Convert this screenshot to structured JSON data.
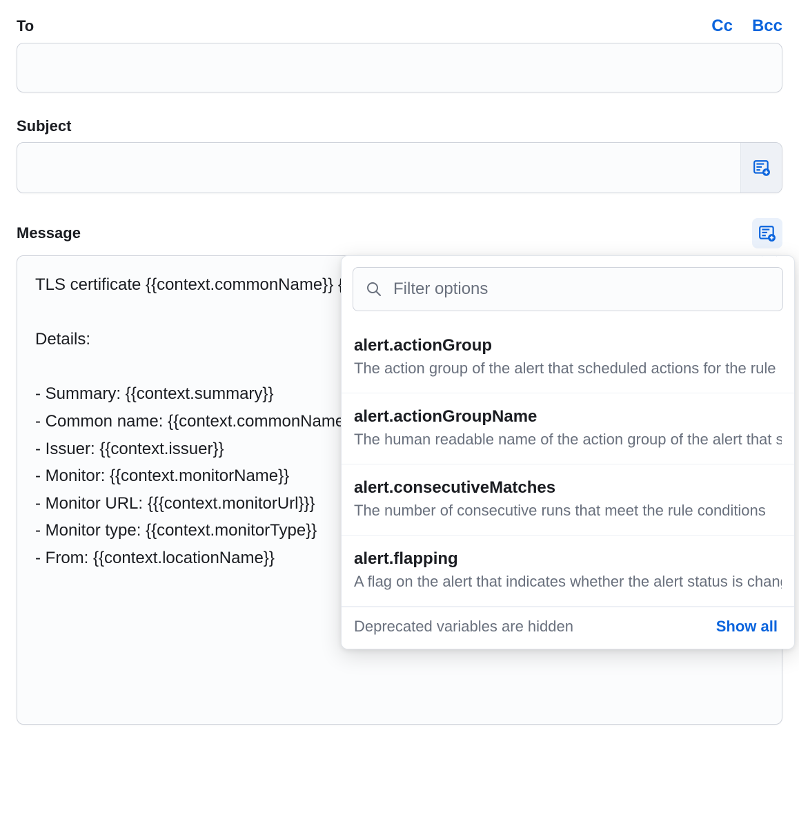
{
  "to": {
    "label": "To",
    "value": "",
    "cc_label": "Cc",
    "bcc_label": "Bcc"
  },
  "subject": {
    "label": "Subject",
    "value": ""
  },
  "message": {
    "label": "Message",
    "value": "TLS certificate {{context.commonName}} {{context.status}} - Elastic Synthetics\n\nDetails:\n\n- Summary: {{context.summary}}\n- Common name: {{context.commonName}}\n- Issuer: {{context.issuer}}\n- Monitor: {{context.monitorName}}\n- Monitor URL: {{{context.monitorUrl}}}\n- Monitor type: {{context.monitorType}}\n- From: {{context.locationName}}"
  },
  "popover": {
    "filter_placeholder": "Filter options",
    "options": [
      {
        "name": "alert.actionGroup",
        "desc": "The action group of the alert that scheduled actions for the rule"
      },
      {
        "name": "alert.actionGroupName",
        "desc": "The human readable name of the action group of the alert that scheduled actions"
      },
      {
        "name": "alert.consecutiveMatches",
        "desc": "The number of consecutive runs that meet the rule conditions"
      },
      {
        "name": "alert.flapping",
        "desc": "A flag on the alert that indicates whether the alert status is changing repeatedly"
      }
    ],
    "footer_text": "Deprecated variables are hidden",
    "footer_link": "Show all"
  }
}
